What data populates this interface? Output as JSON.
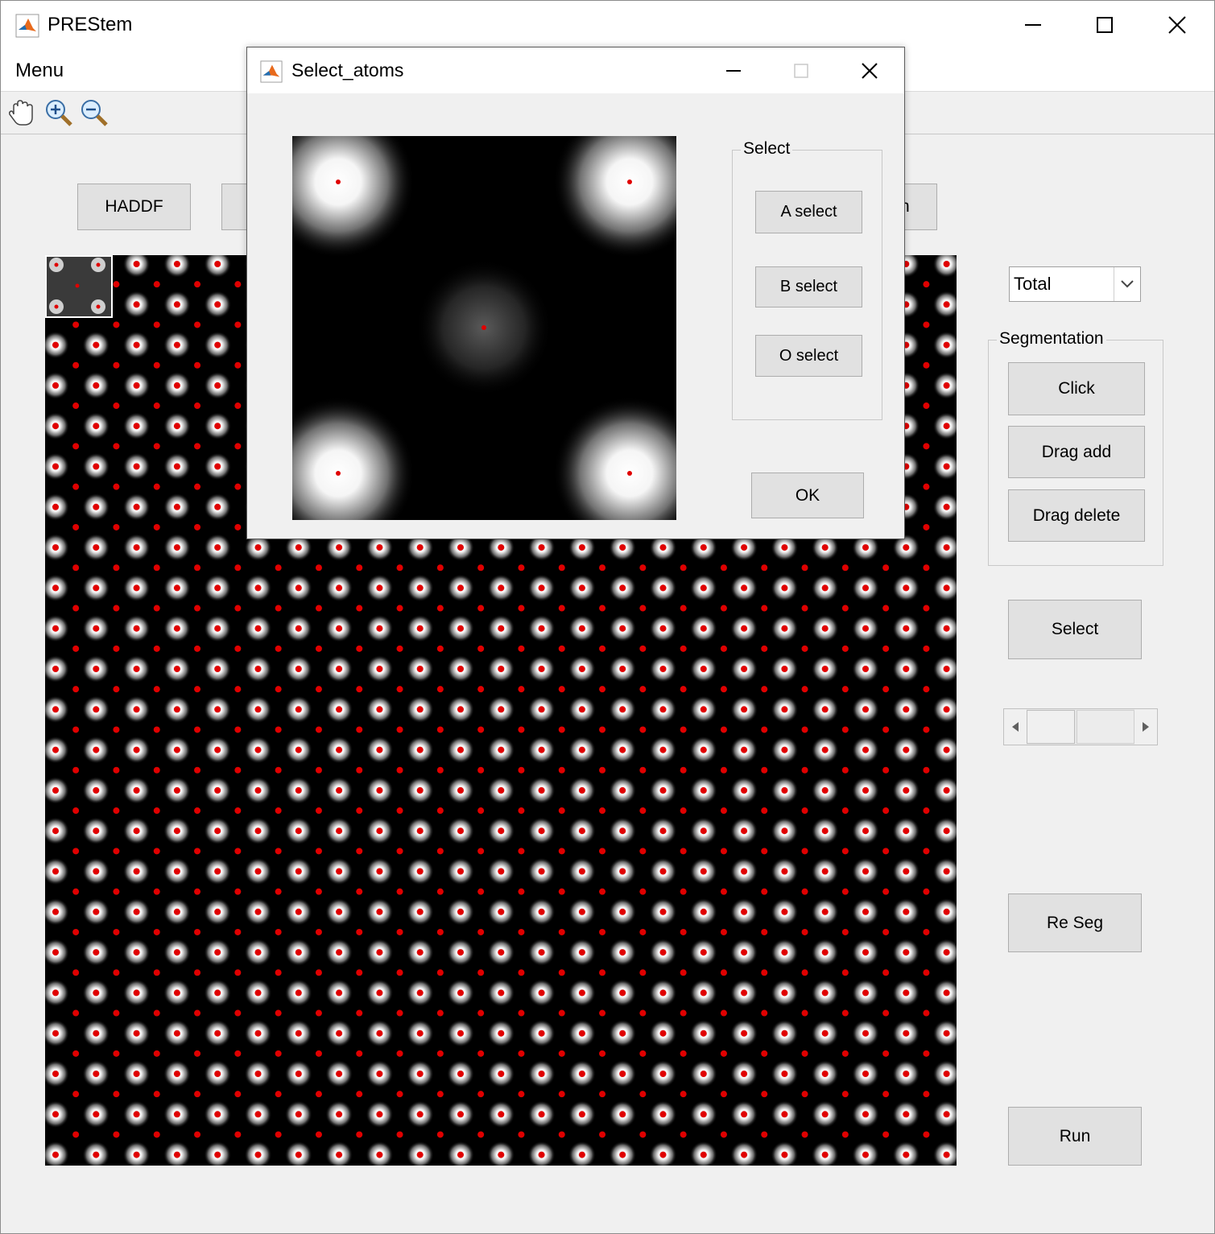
{
  "main_window": {
    "title": "PREStem",
    "menu": [
      "Menu"
    ],
    "toolbar": [
      "pan-tool",
      "zoom-in-tool",
      "zoom-out-tool"
    ],
    "buttons": {
      "haddf": "HADDF",
      "hidden_partial": "n"
    },
    "dropdown": {
      "selected": "Total"
    },
    "segmentation": {
      "legend": "Segmentation",
      "click": "Click",
      "drag_add": "Drag add",
      "drag_delete": "Drag delete"
    },
    "select_button": "Select",
    "re_seg_button": "Re Seg",
    "run_button": "Run",
    "slider": {
      "value": 0.3
    }
  },
  "dialog": {
    "title": "Select_atoms",
    "select_group": {
      "legend": "Select",
      "a_select": "A select",
      "b_select": "B select",
      "o_select": "O select"
    },
    "ok": "OK"
  },
  "colors": {
    "marker": "#e00000",
    "atom": "#ffffff",
    "background": "#000000"
  }
}
